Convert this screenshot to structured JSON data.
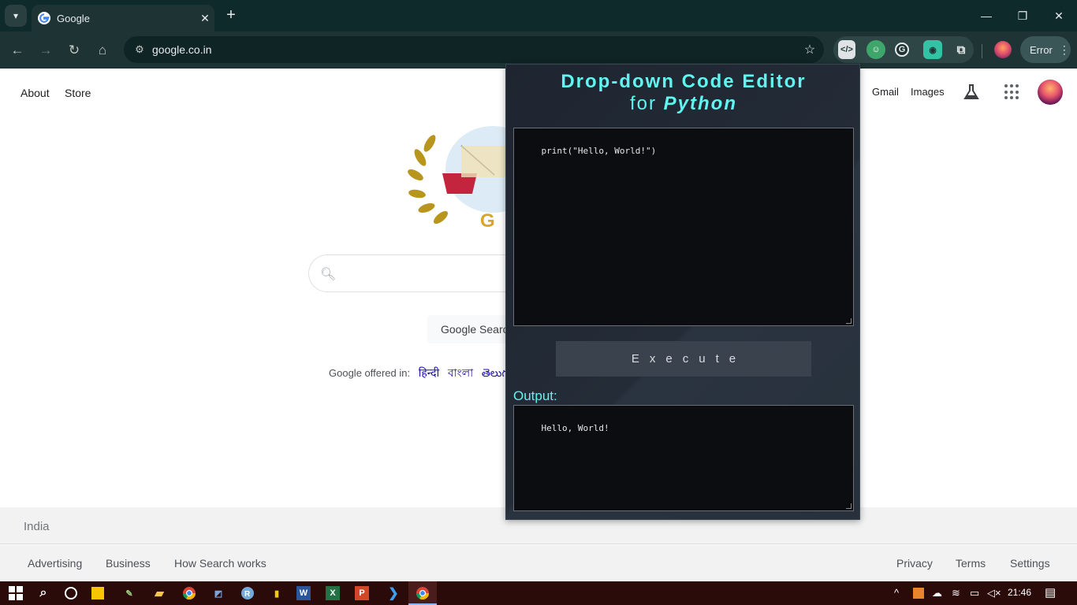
{
  "browser": {
    "tab_title": "Google",
    "url": "google.co.in",
    "profile_status": "Error"
  },
  "google": {
    "top_left_links": [
      "About",
      "Store"
    ],
    "top_right_links": [
      "Gmail",
      "Images"
    ],
    "search_button": "Google Search",
    "offered_in_label": "Google offered in:",
    "languages": [
      "हिन्दी",
      "বাংলা",
      "తెలుగు"
    ],
    "country": "India",
    "footer_left": [
      "Advertising",
      "Business",
      "How Search works"
    ],
    "footer_right": [
      "Privacy",
      "Terms",
      "Settings"
    ]
  },
  "popup": {
    "title": "Drop-down Code Editor",
    "subtitle_prefix": "for",
    "subtitle_lang": "Python",
    "code": "print(\"Hello, World!\")",
    "execute_label": "Execute",
    "output_label": "Output:",
    "output_text": "Hello, World!",
    "accent_color": "#5ff5f0"
  },
  "taskbar": {
    "clock": "21:46"
  }
}
